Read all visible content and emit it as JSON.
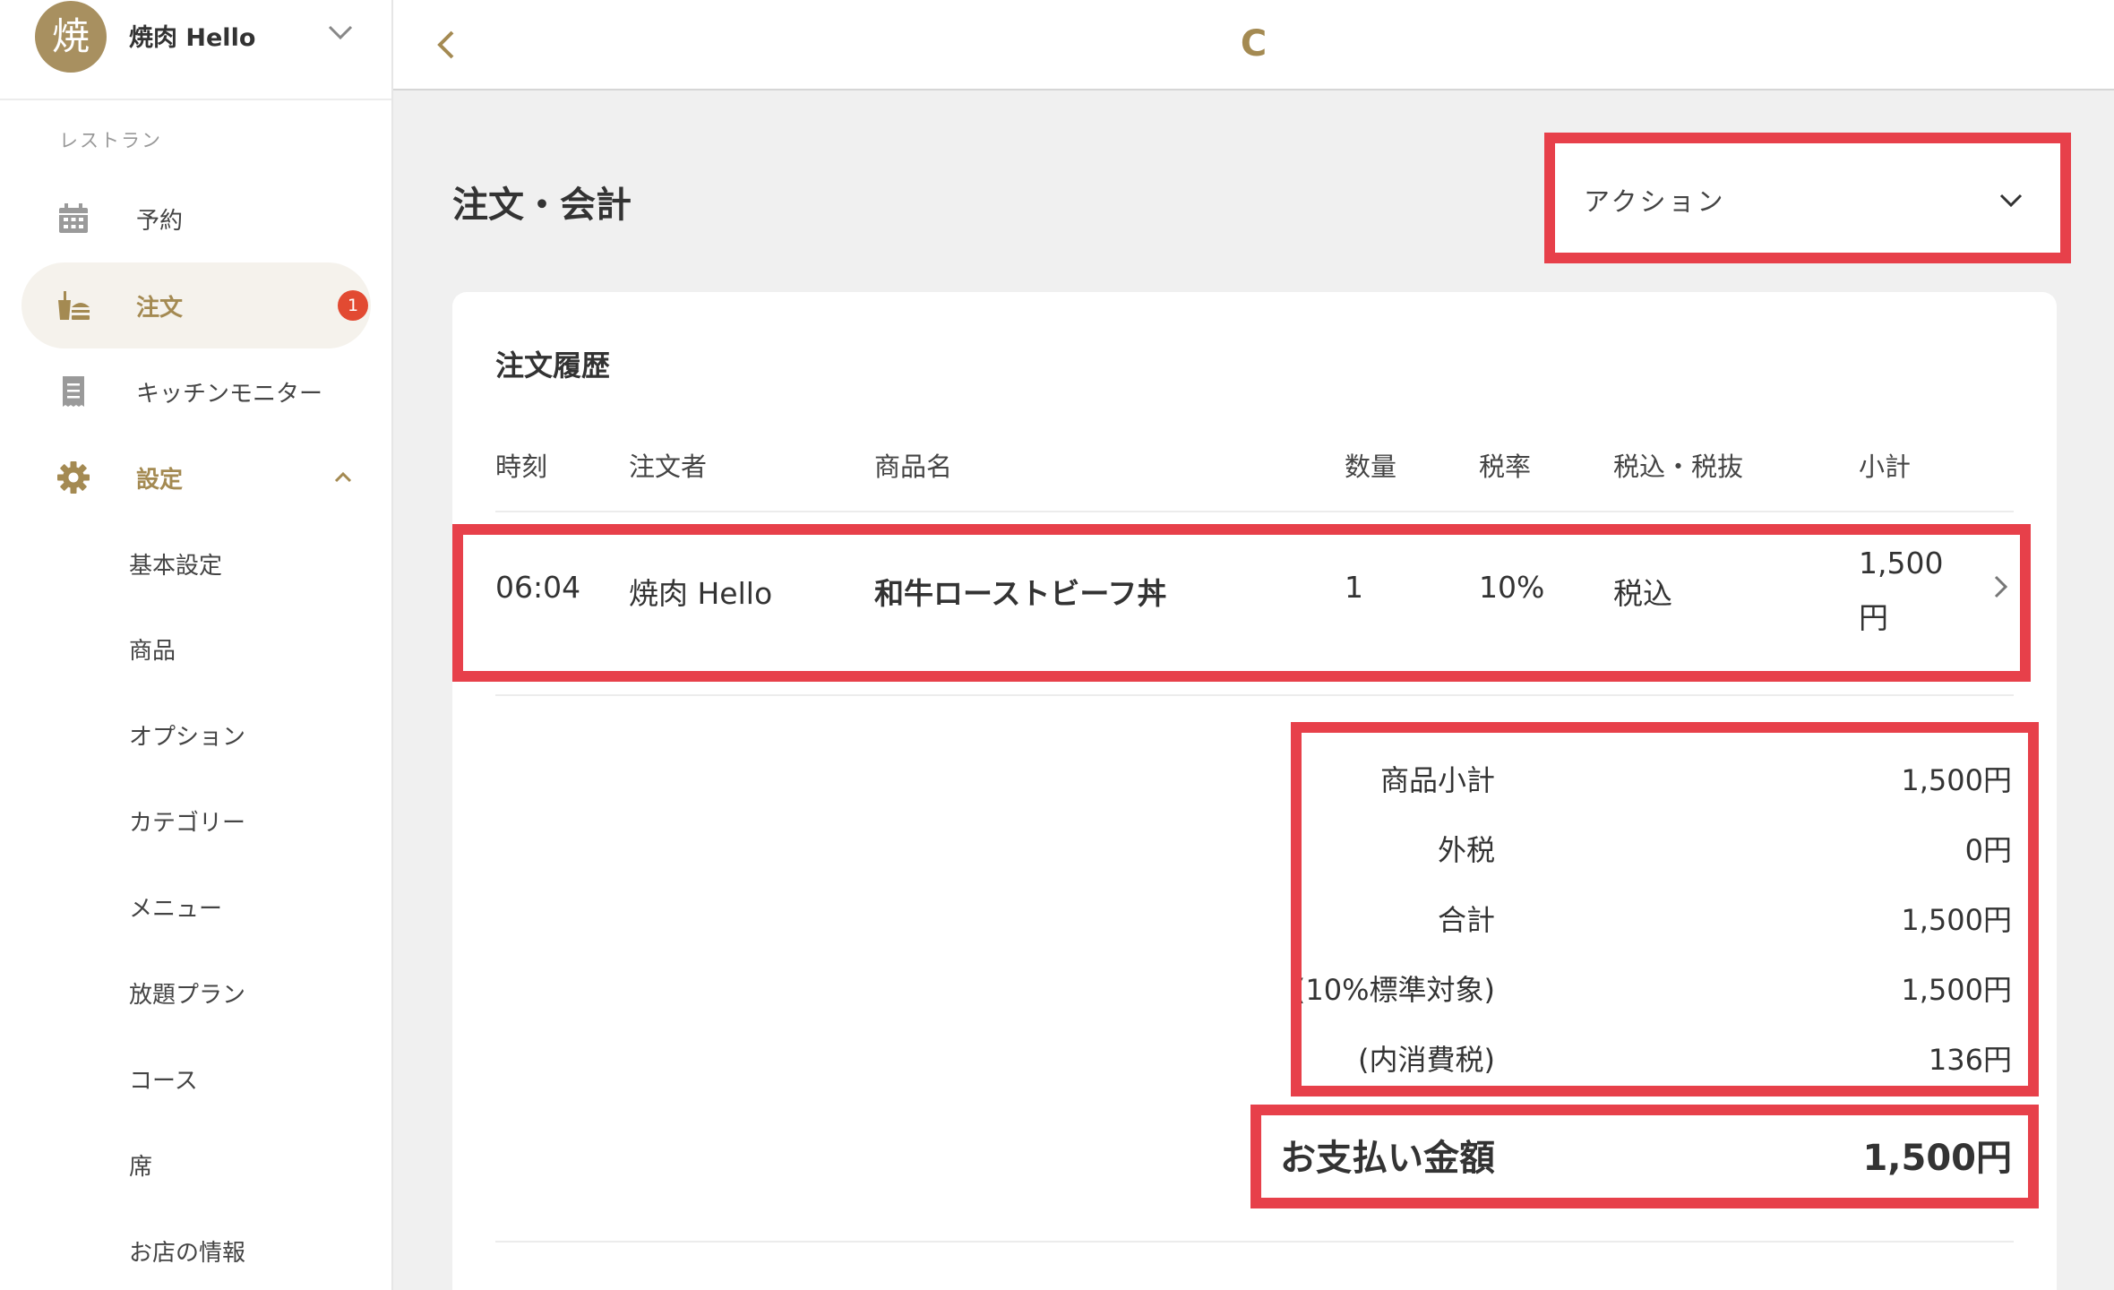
{
  "sidebar": {
    "avatar_char": "焼",
    "shop_name": "焼肉 Hello",
    "section_label": "レストラン",
    "items": [
      {
        "label": "予約"
      },
      {
        "label": "注文",
        "badge": "1"
      },
      {
        "label": "キッチンモニター"
      },
      {
        "label": "設定"
      }
    ],
    "settings_sub": [
      "基本設定",
      "商品",
      "オプション",
      "カテゴリー",
      "メニュー",
      "放題プラン",
      "コース",
      "席",
      "お店の情報"
    ]
  },
  "topbar": {
    "title": "C"
  },
  "page": {
    "title": "注文・会計",
    "action_label": "アクション"
  },
  "order_history": {
    "title": "注文履歴",
    "columns": [
      "時刻",
      "注文者",
      "商品名",
      "数量",
      "税率",
      "税込・税抜",
      "小計"
    ],
    "rows": [
      {
        "time": "06:04",
        "customer": "焼肉 Hello",
        "product": "和牛ローストビーフ丼",
        "qty": "1",
        "tax_rate": "10%",
        "tax_type": "税込",
        "subtotal_line1": "1,500",
        "subtotal_line2": "円"
      }
    ]
  },
  "summary": {
    "rows": [
      {
        "label": "商品小計",
        "value": "1,500円"
      },
      {
        "label": "外税",
        "value": "0円"
      },
      {
        "label": "合計",
        "value": "1,500円"
      },
      {
        "label": "(10%標準対象)",
        "value": "1,500円"
      },
      {
        "label": "(内消費税)",
        "value": "136円"
      }
    ],
    "total_label": "お支払い金額",
    "total_value": "1,500円"
  },
  "colors": {
    "accent_gold": "#a48a52",
    "highlight_red": "#e7404a",
    "badge_red": "#e24a32"
  }
}
